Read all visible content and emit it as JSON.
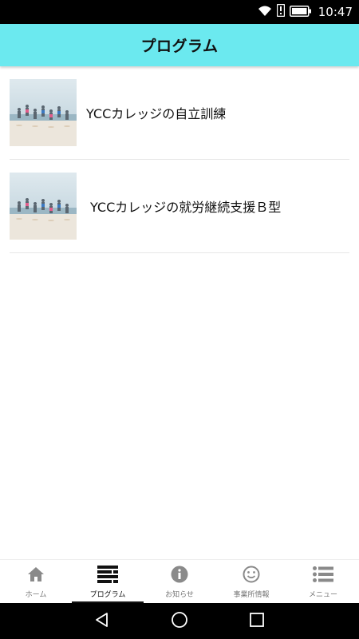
{
  "status_bar": {
    "time": "10:47",
    "icons": [
      "wifi-icon",
      "alert-icon",
      "battery-icon"
    ]
  },
  "app_bar": {
    "title": "プログラム"
  },
  "programs": [
    {
      "label": "YCCカレッジの自立訓練",
      "image": "beach-jump-photo"
    },
    {
      "label": "YCCカレッジの就労継続支援Ｂ型",
      "image": "beach-jump-photo"
    }
  ],
  "bottom_nav": {
    "active": "プログラム",
    "items": [
      {
        "label": "ホーム",
        "icon": "home-icon"
      },
      {
        "label": "プログラム",
        "icon": "list-icon"
      },
      {
        "label": "お知らせ",
        "icon": "info-icon"
      },
      {
        "label": "事業所情報",
        "icon": "smiley-icon"
      },
      {
        "label": "メニュー",
        "icon": "menu-icon"
      }
    ]
  },
  "system_nav": [
    "back-icon",
    "home-circle-icon",
    "recents-icon"
  ],
  "colors": {
    "app_bar": "#6be9ef",
    "status_bar": "#000000",
    "active_nav": "#111111",
    "inactive_nav": "#777777"
  }
}
